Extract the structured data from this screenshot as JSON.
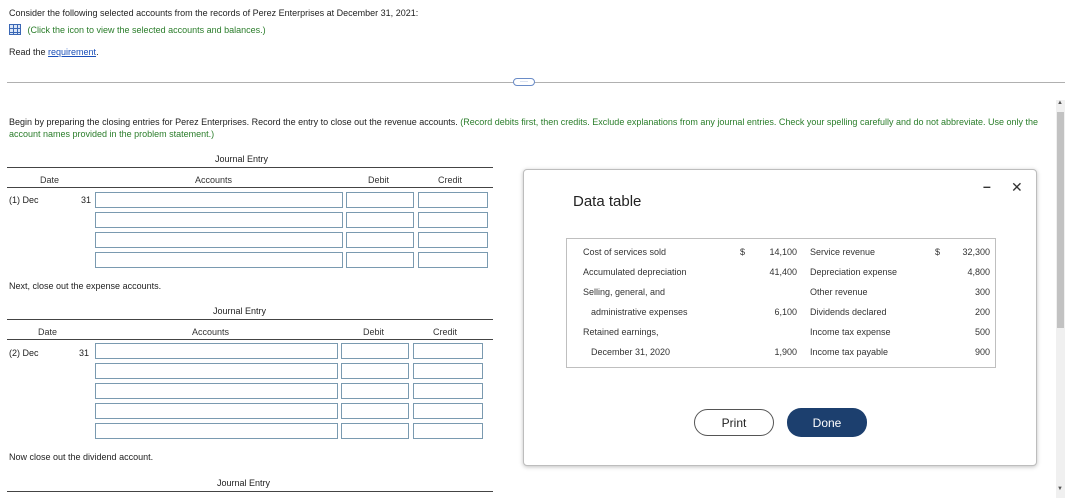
{
  "intro": {
    "line1": "Consider the following selected accounts from the records of Perez Enterprises at December 31, 2021:",
    "icon_link": "(Click the icon to view the selected accounts and balances.)",
    "read_prefix": "Read the ",
    "requirement_link": "requirement",
    "read_suffix": "."
  },
  "collapse_button": "····",
  "instructions": {
    "black": "Begin by preparing the closing entries for Perez Enterprises. Record the entry to close out the revenue accounts.",
    "green": " (Record debits first, then credits. Exclude explanations from any journal entries. Check your spelling carefully and do not abbreviate. Use only the account names provided in the problem statement.)"
  },
  "journal1": {
    "title": "Journal Entry",
    "headers": {
      "date": "Date",
      "accounts": "Accounts",
      "debit": "Debit",
      "credit": "Credit"
    },
    "date_label": "(1) Dec",
    "day": "31"
  },
  "expense_prompt": "Next, close out the expense accounts.",
  "journal2": {
    "title": "Journal Entry",
    "headers": {
      "date": "Date",
      "accounts": "Accounts",
      "debit": "Debit",
      "credit": "Credit"
    },
    "date_label": "(2) Dec",
    "day": "31"
  },
  "dividend_prompt": "Now close out the dividend account.",
  "journal3": {
    "title": "Journal Entry"
  },
  "data_table": {
    "title": "Data table",
    "minimize": "–",
    "close": "✕",
    "left": [
      {
        "label": "Cost of services sold",
        "cur": "$",
        "value": "14,100"
      },
      {
        "label": "Accumulated depreciation",
        "cur": "",
        "value": "41,400"
      },
      {
        "label": "Selling, general, and",
        "cur": "",
        "value": ""
      },
      {
        "label": "administrative expenses",
        "cur": "",
        "value": "6,100"
      },
      {
        "label": "Retained earnings,",
        "cur": "",
        "value": ""
      },
      {
        "label": "December 31, 2020",
        "cur": "",
        "value": "1,900"
      }
    ],
    "right": [
      {
        "label": "Service revenue",
        "cur": "$",
        "value": "32,300"
      },
      {
        "label": "Depreciation expense",
        "cur": "",
        "value": "4,800"
      },
      {
        "label": "Other revenue",
        "cur": "",
        "value": "300"
      },
      {
        "label": "Dividends declared",
        "cur": "",
        "value": "200"
      },
      {
        "label": "Income tax expense",
        "cur": "",
        "value": "500"
      },
      {
        "label": "Income tax payable",
        "cur": "",
        "value": "900"
      }
    ],
    "print_label": "Print",
    "done_label": "Done"
  }
}
